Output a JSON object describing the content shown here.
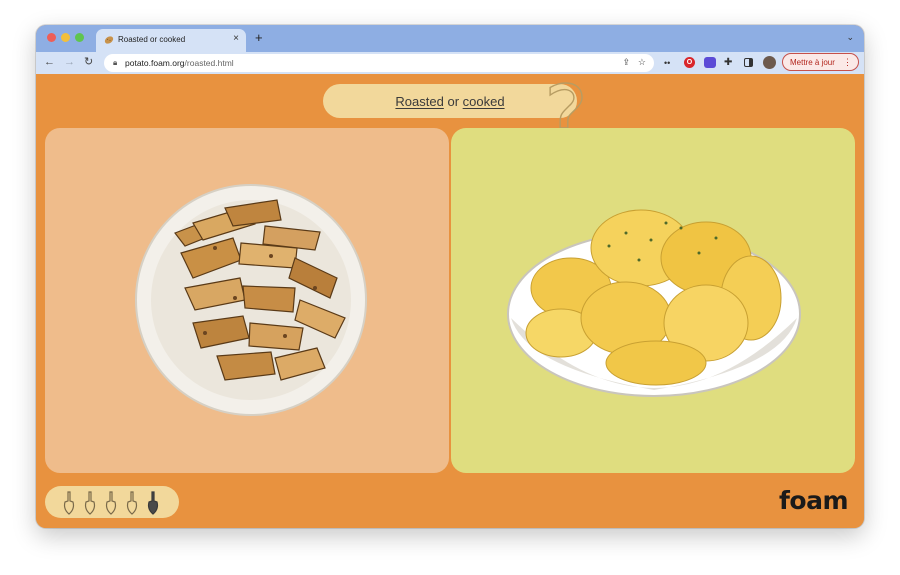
{
  "browser": {
    "tab": {
      "title": "Roasted or cooked",
      "favicon": "potato-icon"
    },
    "url": {
      "host": "potato.foam.org",
      "path": "/roasted.html"
    },
    "update_button": "Mettre à jour"
  },
  "page": {
    "question": {
      "option_a": "Roasted",
      "connector": "or",
      "option_b": "cooked",
      "mark": "?"
    },
    "cards": [
      {
        "id": "roasted",
        "image": "roasted-potato-wedges-plate",
        "background": "#efbc8b"
      },
      {
        "id": "cooked",
        "image": "boiled-potatoes-bowl",
        "background": "#dfdd7f"
      }
    ],
    "progress": {
      "total": 5,
      "current": 5,
      "icon": "shovel-icon"
    },
    "logo": "foam"
  },
  "colors": {
    "page_bg": "#e8923f",
    "pill_bg": "#f2d89b",
    "tab_strip": "#8eaee3",
    "toolbar": "#d5e2f6"
  }
}
